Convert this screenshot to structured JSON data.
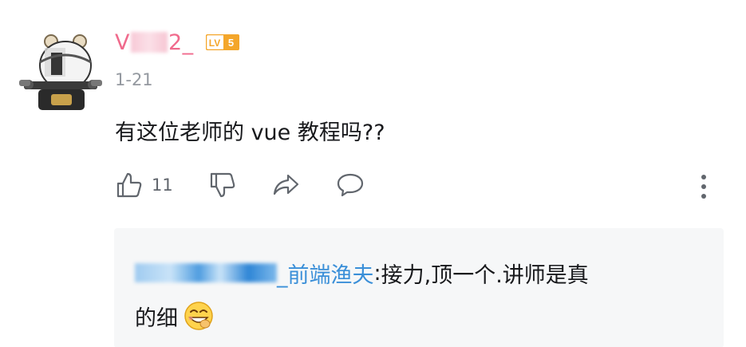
{
  "comment": {
    "username_prefix": "V",
    "username_suffix": "2_",
    "level_badge": "LV5",
    "timestamp": "1-21",
    "text": "有这位老师的 vue 教程吗??",
    "like_count": "11"
  },
  "reply": {
    "author_name": "_前端渔夫",
    "separator": ":",
    "text_line1": " 接力,顶一个.讲师是真",
    "text_line2": "的细"
  },
  "icons": {
    "like": "thumbs-up-icon",
    "dislike": "thumbs-down-icon",
    "share": "share-arrow-icon",
    "reply": "comment-bubble-icon",
    "more": "more-vertical-icon",
    "emoji": "grinning-emoji-icon"
  },
  "colors": {
    "username": "#f06a8c",
    "reply_author": "#3a8fd8",
    "level_badge": "#f4a62a",
    "reply_bg": "#f6f7f8",
    "muted": "#9499a0"
  }
}
